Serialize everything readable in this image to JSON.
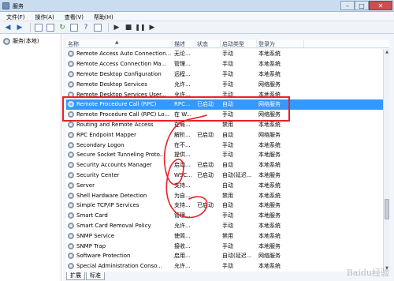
{
  "window": {
    "title": "服务",
    "controls": [
      "–",
      "□",
      "✕"
    ]
  },
  "menu": [
    "文件(F)",
    "操作(A)",
    "查看(V)",
    "帮助(H)"
  ],
  "toolbar": {
    "buttons": [
      "back-icon",
      "forward-icon",
      "show-hide-tree-icon",
      "properties-icon",
      "refresh-icon",
      "export-icon",
      "help-icon",
      "view-icon",
      "start-icon",
      "stop-icon",
      "pause-icon",
      "restart-icon"
    ]
  },
  "tree": {
    "label": "服务(本地)"
  },
  "columns": {
    "name": "名称",
    "desc": "描述",
    "status": "状态",
    "startup": "启动类型",
    "logon": "登录为"
  },
  "services": [
    {
      "name": "Remote Access Auto Connection...",
      "desc": "无论...",
      "status": "",
      "startup": "手动",
      "logon": "本地系统"
    },
    {
      "name": "Remote Access Connection Ma...",
      "desc": "管理...",
      "status": "",
      "startup": "手动",
      "logon": "本地系统"
    },
    {
      "name": "Remote Desktop Configuration",
      "desc": "远程...",
      "status": "",
      "startup": "手动",
      "logon": "本地系统"
    },
    {
      "name": "Remote Desktop Services",
      "desc": "允许...",
      "status": "",
      "startup": "手动",
      "logon": "网络服务"
    },
    {
      "name": "Remote Desktop Services User...",
      "desc": "允许...",
      "status": "",
      "startup": "手动",
      "logon": "本地系统"
    },
    {
      "name": "Remote Procedure Call (RPC)",
      "desc": "RPC...",
      "status": "已启动",
      "startup": "自动",
      "logon": "网络服务",
      "selected": true
    },
    {
      "name": "Remote Procedure Call (RPC) Lo...",
      "desc": "在 W...",
      "status": "",
      "startup": "手动",
      "logon": "网络服务"
    },
    {
      "name": "Routing and Remote Access",
      "desc": "在局...",
      "status": "",
      "startup": "禁用",
      "logon": "本地系统"
    },
    {
      "name": "RPC Endpoint Mapper",
      "desc": "解析...",
      "status": "已启动",
      "startup": "自动",
      "logon": "网络服务"
    },
    {
      "name": "Secondary Logon",
      "desc": "在不...",
      "status": "",
      "startup": "手动",
      "logon": "本地系统"
    },
    {
      "name": "Secure Socket Tunneling Proto...",
      "desc": "提供...",
      "status": "",
      "startup": "手动",
      "logon": "本地服务"
    },
    {
      "name": "Security Accounts Manager",
      "desc": "启动...",
      "status": "已启动",
      "startup": "自动",
      "logon": "本地系统"
    },
    {
      "name": "Security Center",
      "desc": "WSC...",
      "status": "已启动",
      "startup": "自动(延迟...",
      "logon": "本地服务"
    },
    {
      "name": "Server",
      "desc": "支持...",
      "status": "",
      "startup": "自动",
      "logon": "本地系统"
    },
    {
      "name": "Shell Hardware Detection",
      "desc": "为自...",
      "status": "",
      "startup": "禁用",
      "logon": "本地系统"
    },
    {
      "name": "Simple TCP/IP Services",
      "desc": "支持...",
      "status": "已启动",
      "startup": "自动",
      "logon": "本地服务"
    },
    {
      "name": "Smart Card",
      "desc": "管理...",
      "status": "",
      "startup": "手动",
      "logon": "本地服务"
    },
    {
      "name": "Smart Card Removal Policy",
      "desc": "允许...",
      "status": "",
      "startup": "手动",
      "logon": "本地系统"
    },
    {
      "name": "SNMP Service",
      "desc": "使简...",
      "status": "",
      "startup": "禁用",
      "logon": "本地系统"
    },
    {
      "name": "SNMP Trap",
      "desc": "接收...",
      "status": "",
      "startup": "手动",
      "logon": "本地服务"
    },
    {
      "name": "Software Protection",
      "desc": "启用...",
      "status": "",
      "startup": "自动(延迟...",
      "logon": "网络服务"
    },
    {
      "name": "Special Administration Conso...",
      "desc": "允许...",
      "status": "",
      "startup": "手动",
      "logon": "本地系统"
    }
  ],
  "tabs": [
    "扩展",
    "标准"
  ],
  "watermark": "Baidu经验",
  "colors": {
    "selection": "#3399ff",
    "annotation": "#e8202a"
  }
}
